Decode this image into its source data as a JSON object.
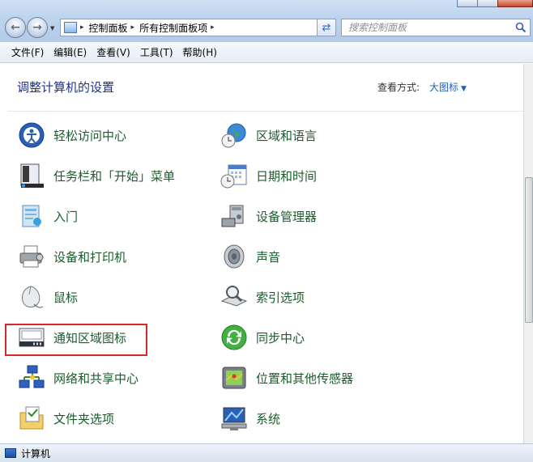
{
  "address": {
    "crumbs": [
      "控制面板",
      "所有控制面板项"
    ],
    "separator": "▸"
  },
  "search": {
    "placeholder": "搜索控制面板"
  },
  "menu": [
    "文件(F)",
    "编辑(E)",
    "查看(V)",
    "工具(T)",
    "帮助(H)"
  ],
  "header": {
    "title": "调整计算机的设置",
    "view_by_label": "查看方式:",
    "view_by_value": "大图标"
  },
  "items_left": [
    {
      "label": "轻松访问中心",
      "icon": "ease-of-access-icon"
    },
    {
      "label": "任务栏和「开始」菜单",
      "icon": "taskbar-icon"
    },
    {
      "label": "入门",
      "icon": "getting-started-icon"
    },
    {
      "label": "设备和打印机",
      "icon": "printer-icon"
    },
    {
      "label": "鼠标",
      "icon": "mouse-icon"
    },
    {
      "label": "通知区域图标",
      "icon": "notification-icon"
    },
    {
      "label": "网络和共享中心",
      "icon": "network-icon"
    },
    {
      "label": "文件夹选项",
      "icon": "folder-options-icon"
    }
  ],
  "items_right": [
    {
      "label": "区域和语言",
      "icon": "globe-clock-icon"
    },
    {
      "label": "日期和时间",
      "icon": "calendar-icon"
    },
    {
      "label": "设备管理器",
      "icon": "device-manager-icon"
    },
    {
      "label": "声音",
      "icon": "speaker-icon"
    },
    {
      "label": "索引选项",
      "icon": "indexing-icon"
    },
    {
      "label": "同步中心",
      "icon": "sync-icon"
    },
    {
      "label": "位置和其他传感器",
      "icon": "location-sensor-icon"
    },
    {
      "label": "系统",
      "icon": "system-icon"
    }
  ],
  "highlighted_item": "通知区域图标",
  "status": {
    "text": "计算机"
  },
  "colors": {
    "item_text": "#1a5c2b",
    "title": "#1e3287",
    "link": "#1e5fb4",
    "highlight_border": "#d42a2a"
  }
}
